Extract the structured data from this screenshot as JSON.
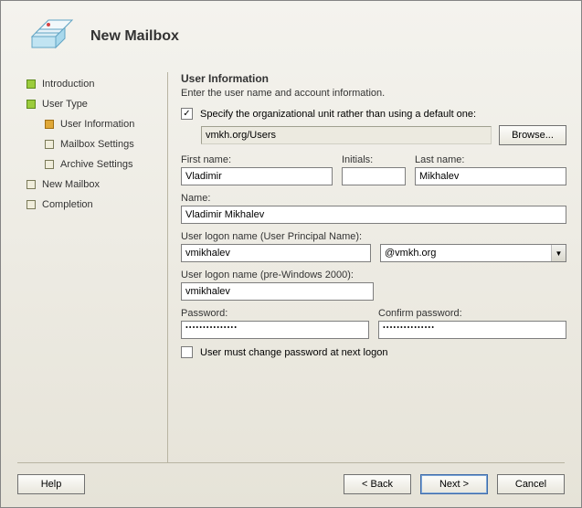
{
  "header": {
    "title": "New Mailbox"
  },
  "sidebar": {
    "items": [
      {
        "label": "Introduction",
        "state": "done",
        "indent": false
      },
      {
        "label": "User Type",
        "state": "done",
        "indent": false
      },
      {
        "label": "User Information",
        "state": "active",
        "indent": true
      },
      {
        "label": "Mailbox Settings",
        "state": "pending",
        "indent": true
      },
      {
        "label": "Archive Settings",
        "state": "pending",
        "indent": true
      },
      {
        "label": "New Mailbox",
        "state": "pending",
        "indent": false
      },
      {
        "label": "Completion",
        "state": "pending",
        "indent": false
      }
    ]
  },
  "content": {
    "section_title": "User Information",
    "section_sub": "Enter the user name and account information.",
    "ou_checkbox_label": "Specify the organizational unit rather than using a default one:",
    "ou_checked": true,
    "ou_value": "vmkh.org/Users",
    "browse_label": "Browse...",
    "first_name_label": "First name:",
    "first_name_value": "Vladimir",
    "initials_label": "Initials:",
    "initials_value": "",
    "last_name_label": "Last name:",
    "last_name_value": "Mikhalev",
    "name_label": "Name:",
    "name_value": "Vladimir Mikhalev",
    "upn_label": "User logon name (User Principal Name):",
    "upn_value": "vmikhalev",
    "upn_domain": "@vmkh.org",
    "pre2000_label": "User logon name (pre-Windows 2000):",
    "pre2000_value": "vmikhalev",
    "password_label": "Password:",
    "password_value": "•••••••••••••••",
    "confirm_label": "Confirm password:",
    "confirm_value": "•••••••••••••••",
    "must_change_label": "User must change password at next logon",
    "must_change_checked": false
  },
  "footer": {
    "help": "Help",
    "back": "< Back",
    "next": "Next >",
    "cancel": "Cancel"
  }
}
